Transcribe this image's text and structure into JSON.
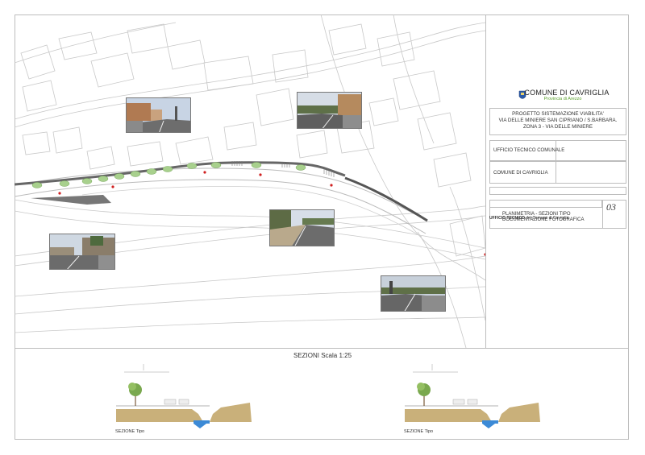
{
  "title_block": {
    "comune": "COMUNE DI CAVRIGLIA",
    "provincia": "Provincia di Arezzo",
    "project_lines": [
      "PROGETTO SISTEMAZIONE VIABILITA'",
      "VIA DELLE MINIERE SAN CIPRIANO / S.BARBARA.",
      "ZONA 3 -  VIA DELLE MINIERE"
    ],
    "ufficio": "UFFICIO TECNICO COMUNALE",
    "comune_box": "COMUNE DI CAVRIGLIA",
    "drawing_lines": [
      "PLANIMETRIA - SEZIONI TIPO",
      "DOCUMENTAZIONE FOTOGRAFICA"
    ],
    "sheet_number": "03",
    "footer_bold": "UFFICIO TECNICO",
    "footer_rest": "del Comune di Cavriglia"
  },
  "sections": {
    "title": "SEZIONI Scala 1:25",
    "left_label": "SEZIONE  Tipo",
    "right_label": "SEZIONE  Tipo"
  },
  "colors": {
    "road_marking": "#5a5a5a",
    "tree_green": "#a8d08d",
    "photo_sky": "#c8d4e4",
    "ground": "#c9b07a",
    "water": "#3c8ad6",
    "accent_green": "#5aa02c"
  }
}
